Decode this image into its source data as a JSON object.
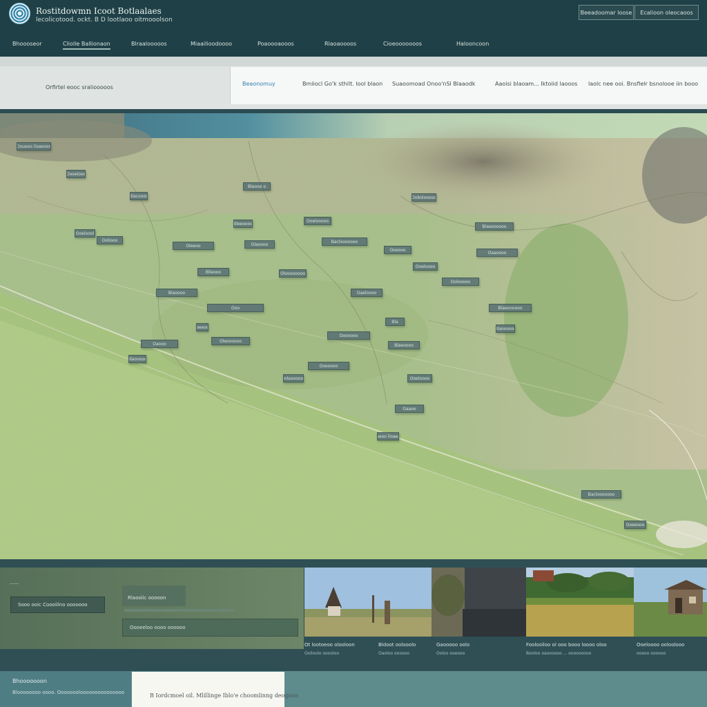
{
  "header": {
    "title": "Rostitdowmn Icoot Botlaalaes",
    "subtitle": "lecolicotood. ockt. B D lootlaoo oitmooolson",
    "buttons": [
      "Beeadoomar loose",
      "Ecalioon oleocaoos"
    ]
  },
  "nav": {
    "items": [
      "Bhoooseor",
      "Cliolle Ballionaon",
      "Blraalooooos",
      "Miaailioodoooo",
      "Poaoooaooos",
      "Rlaoaoooos",
      "Cioeooooooos",
      "Halooncoon"
    ],
    "active_index": 1
  },
  "filters": {
    "caption": "Orfirtel eooc sraliooooos",
    "tabs": [
      "Beaonomuy",
      "Bmiiocl Go'k sthilt. lool blaon",
      "Suaoomoad Onoo'nSl Blaaodk",
      "Aaoisi blaoam... Iktoiid laooos",
      "laolc nee ooi. Bnsfielr bsnolooe iin booo"
    ],
    "active_index": 0
  },
  "map": {
    "labels": [
      "Ooueoo lioaeooo",
      "Oooelooo",
      "Blacoooo",
      "Blaooo o",
      "Oobolooooo",
      "Ooeloool",
      "Ooliooo",
      "Bleeoooo",
      "Ooelooooo",
      "Blaeoooooo",
      "Oleeoo",
      "Olaoooo",
      "Baclooooooo",
      "Ooeooo",
      "Oaaoooo",
      "Blleooo",
      "Oloooooooo",
      "Ooeloooo",
      "Oolooooo",
      "Blaoooo",
      "Oaeloooo",
      "Ooo",
      "Blaeoooooo",
      "Ooeeooo",
      "Bla",
      "Olaoooooo",
      "Ooooooo",
      "Oleoooooo",
      "Oaooo",
      "Blaeoooo",
      "Blaooooo",
      "Ooeoooo",
      "Ooeloooo",
      "Oolaoooooo",
      "Oaaoo"
    ]
  },
  "lower_panel": {
    "tag": "------",
    "select_value": "Sooo ooic Coooiilno ooooooo",
    "card_label": "Rlaooiic ooooon",
    "input_text": "Oooeeloo oooo oooooo"
  },
  "photos": [
    {
      "icon": "church-photo",
      "caption": "Ot lootoeoo olooloon",
      "sub": "Ooiloolo ooooloo"
    },
    {
      "icon": "sky-photo",
      "caption": "Bldoot oolooolo",
      "sub": "Oaoloo oooooo"
    },
    {
      "icon": "village-photo",
      "caption": "Gaooooo oolo",
      "sub": "Ooloo ooeooo"
    },
    {
      "icon": "field-photo",
      "caption": "Foolooiloo ol ooo booo loooo oloo",
      "sub": "Booloo oaoooooo ... ooooooooo"
    },
    {
      "icon": "house-photo",
      "caption": "Ooeloooo ooloolooo",
      "sub": "ooeoo oooooo"
    }
  ],
  "footer": {
    "title": "Bhooooooon",
    "text": "Bloooooooo oooo. Ooooooolooooooooooooooo",
    "card_text": "B Iordcmoel oil. Mlillinge Iblo'e choomlinng deogoon"
  },
  "colors": {
    "header_bg": "#1f4046",
    "map_green": "#a9c08e",
    "accent_blue": "#2f7cb0"
  }
}
